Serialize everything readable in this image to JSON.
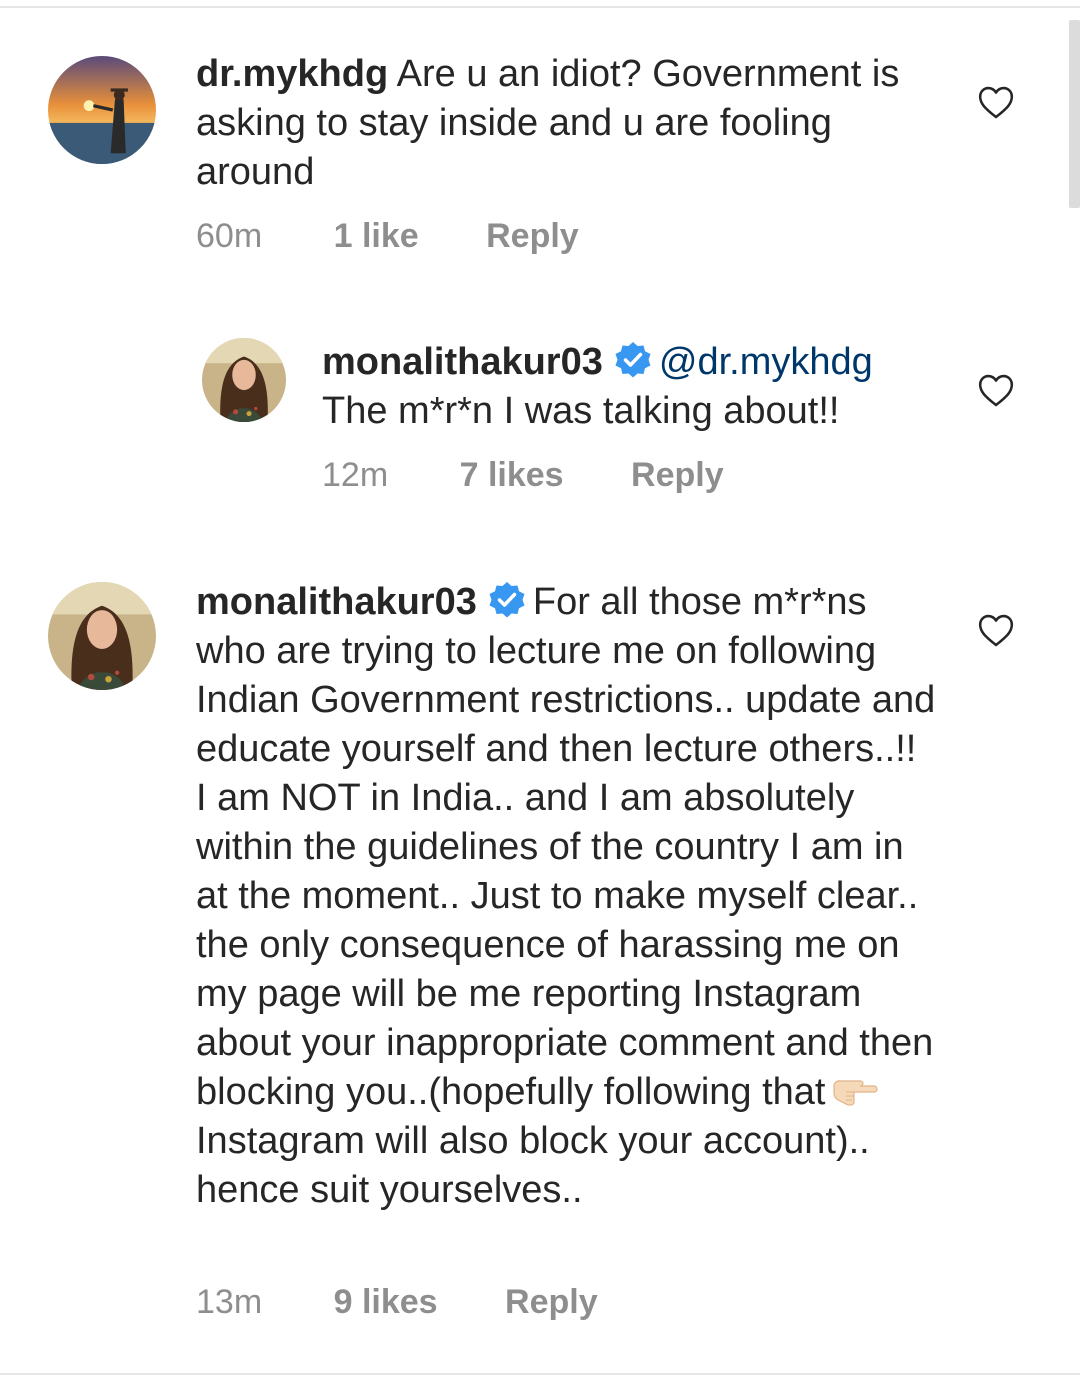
{
  "comments": [
    {
      "username": "dr.mykhdg",
      "verified": false,
      "text": "Are u an idiot? Government is asking to stay inside and u are fooling around",
      "time": "60m",
      "likes": "1 like",
      "reply": "Reply"
    },
    {
      "username": "monalithakur03",
      "verified": true,
      "mention": "@dr.mykhdg",
      "text": "The m*r*n I was talking about!!",
      "time": "12m",
      "likes": "7 likes",
      "reply": "Reply"
    },
    {
      "username": "monalithakur03",
      "verified": true,
      "text_before_emoji": "For all those m*r*ns who are trying to lecture me on following Indian Government restrictions.. update and educate yourself and then lecture others..!! I am NOT in India.. and I am absolutely within the guidelines of the country I am in at the moment.. Just to make myself clear.. the only consequence of harassing me on my page will be me reporting Instagram about your inappropriate comment and then blocking you..(hopefully following that",
      "emoji": "pointing-right-hand-emoji",
      "text_after_emoji": "Instagram will also block your account).. hence suit yourselves..",
      "time": "13m",
      "likes": "9 likes",
      "reply": "Reply"
    }
  ],
  "colors": {
    "text": "#262626",
    "secondary": "#8e8e8e",
    "verified_blue": "#3897f0",
    "mention": "#00376b"
  },
  "icons": {
    "like": "heart-outline-icon",
    "verified": "verified-badge-icon"
  }
}
